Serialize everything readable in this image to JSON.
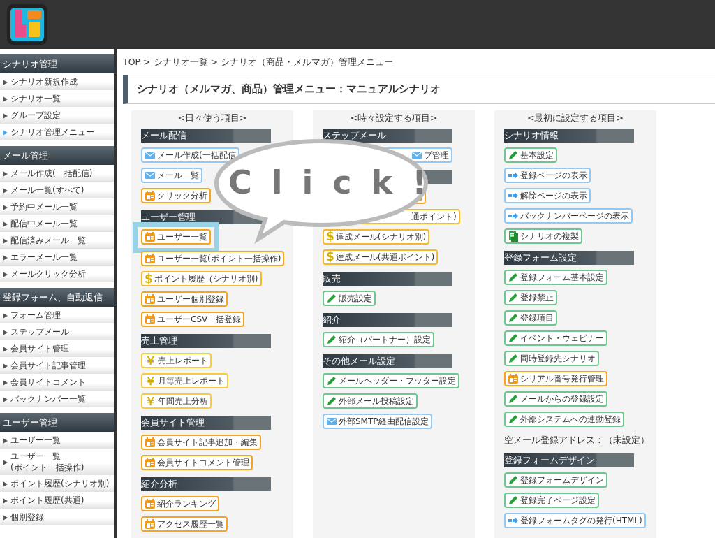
{
  "sidebar": [
    {
      "title": "シナリオ管理",
      "items": [
        {
          "label": "シナリオ新規作成",
          "selected": false
        },
        {
          "label": "シナリオ一覧",
          "selected": false
        },
        {
          "label": "グループ設定",
          "selected": false
        },
        {
          "label": "シナリオ管理メニュー",
          "selected": true
        }
      ]
    },
    {
      "title": "メール管理",
      "items": [
        {
          "label": "メール作成(一括配信)",
          "selected": false
        },
        {
          "label": "メール一覧(すべて)",
          "selected": false
        },
        {
          "label": "予約中メール一覧",
          "selected": false
        },
        {
          "label": "配信中メール一覧",
          "selected": false
        },
        {
          "label": "配信済みメール一覧",
          "selected": false
        },
        {
          "label": "エラーメール一覧",
          "selected": false
        },
        {
          "label": "メールクリック分析",
          "selected": false
        }
      ]
    },
    {
      "title": "登録フォーム、自動返信",
      "items": [
        {
          "label": "フォーム管理",
          "selected": false
        },
        {
          "label": "ステップメール",
          "selected": false
        },
        {
          "label": "会員サイト管理",
          "selected": false
        },
        {
          "label": "会員サイト記事管理",
          "selected": false
        },
        {
          "label": "会員サイトコメント",
          "selected": false
        },
        {
          "label": "バックナンバー一覧",
          "selected": false
        }
      ]
    },
    {
      "title": "ユーザー管理",
      "items": [
        {
          "label": "ユーザー一覧",
          "selected": false
        },
        {
          "label": "ユーザー一覧\n(ポイント一括操作)",
          "selected": false
        },
        {
          "label": "ポイント履歴(シナリオ別)",
          "selected": false
        },
        {
          "label": "ポイント履歴(共通)",
          "selected": false
        },
        {
          "label": "個別登録",
          "selected": false
        }
      ]
    }
  ],
  "breadcrumb": [
    {
      "label": "TOP",
      "link": true
    },
    {
      "label": ">",
      "link": false
    },
    {
      "label": "シナリオ一覧",
      "link": true
    },
    {
      "label": ">",
      "link": false
    },
    {
      "label": "シナリオ（商品・メルマガ）管理メニュー",
      "link": false
    }
  ],
  "page_title": "シナリオ（メルマガ、商品）管理メニュー：マニュアルシナリオ",
  "columns": [
    {
      "heading": "<日々使う項目>",
      "sections": [
        {
          "title": "メール配信",
          "items": [
            {
              "kind": "mail",
              "label": "メール作成(一括配信",
              "highlighted": false
            },
            {
              "kind": "mail",
              "label": "メール一覧",
              "highlighted": false
            },
            {
              "kind": "card",
              "label": "クリック分析",
              "highlighted": false
            }
          ]
        },
        {
          "title": "ユーザー管理",
          "items": [
            {
              "kind": "card",
              "label": "ユーザー一覧",
              "highlighted": true
            },
            {
              "kind": "card",
              "label": "ユーザー一覧(ポイント一括操作)",
              "highlighted": false
            },
            {
              "kind": "dollar",
              "glyph": "$",
              "label": "ポイント履歴（シナリオ別)",
              "highlighted": false
            },
            {
              "kind": "card",
              "label": "ユーザー個別登録",
              "highlighted": false
            },
            {
              "kind": "card",
              "label": "ユーザーCSV一括登録",
              "highlighted": false
            }
          ]
        },
        {
          "title": "売上管理",
          "items": [
            {
              "kind": "yen",
              "glyph": "￥",
              "label": "売上レポート",
              "highlighted": false
            },
            {
              "kind": "yen",
              "glyph": "￥",
              "label": "月毎売上レポート",
              "highlighted": false
            },
            {
              "kind": "yen",
              "glyph": "￥",
              "label": "年間売上分析",
              "highlighted": false
            }
          ]
        },
        {
          "title": "会員サイト管理",
          "items": [
            {
              "kind": "card",
              "label": "会員サイト記事追加・編集",
              "highlighted": false
            },
            {
              "kind": "card",
              "label": "会員サイトコメント管理",
              "highlighted": false
            }
          ]
        },
        {
          "title": "紹介分析",
          "items": [
            {
              "kind": "card",
              "label": "紹介ランキング",
              "highlighted": false
            },
            {
              "kind": "card",
              "label": "アクセス履歴一覧",
              "highlighted": false
            }
          ]
        }
      ]
    },
    {
      "heading": "<時々設定する項目>",
      "sections": [
        {
          "title": "ステップメール",
          "items": [
            {
              "kind": "mail",
              "label": "プ管理",
              "covered": true,
              "highlighted": false
            }
          ]
        },
        {
          "items": [
            {
              "kind": "card",
              "covered": true
            },
            {
              "kind": "dollar",
              "label": "通ポイント)",
              "covered": true,
              "highlighted": false
            },
            {
              "kind": "dollar",
              "glyph": "$",
              "label": "達成メール(シナリオ別)",
              "highlighted": false
            },
            {
              "kind": "dollar",
              "glyph": "$",
              "label": "達成メール(共通ポイント)",
              "highlighted": false
            }
          ]
        },
        {
          "title": "販売",
          "items": [
            {
              "kind": "pencil",
              "label": "販売設定",
              "highlighted": false
            }
          ]
        },
        {
          "title": "紹介",
          "items": [
            {
              "kind": "pencil",
              "label": "紹介（パートナー）設定",
              "highlighted": false
            }
          ]
        },
        {
          "title": "その他メール設定",
          "items": [
            {
              "kind": "pencil",
              "label": "メールヘッダー・フッター設定",
              "highlighted": false
            },
            {
              "kind": "pencil",
              "label": "外部メール投稿設定",
              "highlighted": false
            },
            {
              "kind": "mail",
              "label": "外部SMTP経由配信設定",
              "highlighted": false
            }
          ]
        }
      ]
    },
    {
      "heading": "<最初に設定する項目>",
      "sections": [
        {
          "title": "シナリオ情報",
          "items": [
            {
              "kind": "pencil",
              "label": "基本設定",
              "highlighted": false
            },
            {
              "kind": "arrow",
              "label": "登録ページの表示",
              "highlighted": false
            },
            {
              "kind": "arrow",
              "label": "解除ページの表示",
              "highlighted": false
            },
            {
              "kind": "arrow",
              "label": "バックナンバーページの表示",
              "highlighted": false
            },
            {
              "kind": "copy",
              "label": "シナリオの複製",
              "highlighted": false
            }
          ]
        },
        {
          "title": "登録フォーム設定",
          "items": [
            {
              "kind": "pencil",
              "label": "登録フォーム基本設定",
              "highlighted": false
            },
            {
              "kind": "pencil",
              "label": "登録禁止",
              "highlighted": false
            },
            {
              "kind": "pencil",
              "label": "登録項目",
              "highlighted": false
            },
            {
              "kind": "pencil",
              "label": "イベント・ウェビナー",
              "highlighted": false
            },
            {
              "kind": "pencil",
              "label": "同時登録先シナリオ",
              "highlighted": false
            },
            {
              "kind": "card",
              "label": "シリアル番号発行管理",
              "highlighted": false
            },
            {
              "kind": "pencil",
              "label": "メールからの登録設定",
              "highlighted": false
            },
            {
              "kind": "pencil",
              "label": "外部システムへの連動登録",
              "highlighted": false
            },
            {
              "kind": "text",
              "label": "空メール登録アドレス：（未設定）"
            }
          ]
        },
        {
          "title": "登録フォームデザイン",
          "items": [
            {
              "kind": "pencil",
              "label": "登録フォームデザイン",
              "highlighted": false
            },
            {
              "kind": "pencil",
              "label": "登録完了ページ設定",
              "highlighted": false
            },
            {
              "kind": "arrow",
              "label": "登録フォームタグの発行(HTML)",
              "highlighted": false
            }
          ]
        }
      ]
    }
  ],
  "callout": {
    "text": "C l i c k !"
  }
}
